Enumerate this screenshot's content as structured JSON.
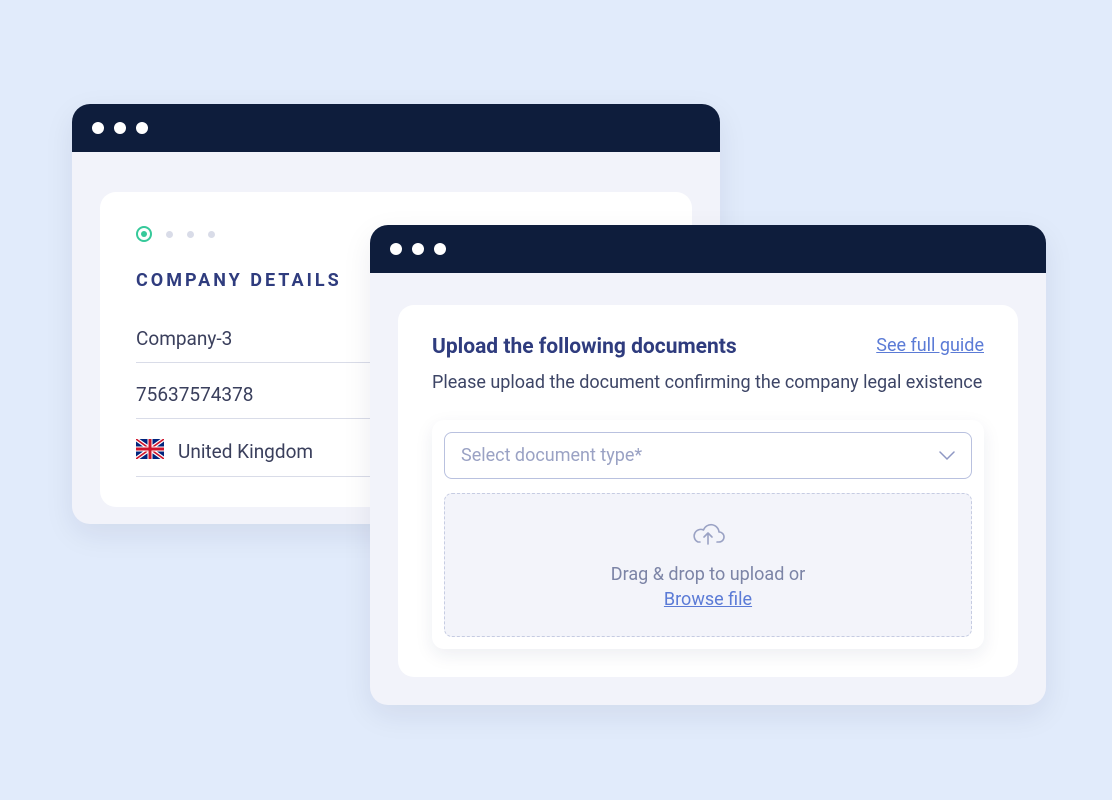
{
  "window1": {
    "section_title": "COMPANY DETAILS",
    "company_name": "Company-3",
    "company_number": "75637574378",
    "country": "United Kingdom"
  },
  "window2": {
    "title": "Upload the following documents",
    "guide_link": "See full guide",
    "description": "Please upload the document confirming the company legal existence",
    "doctype_placeholder": "Select document type*",
    "drop_text": "Drag & drop to upload or",
    "browse_text": "Browse file"
  }
}
